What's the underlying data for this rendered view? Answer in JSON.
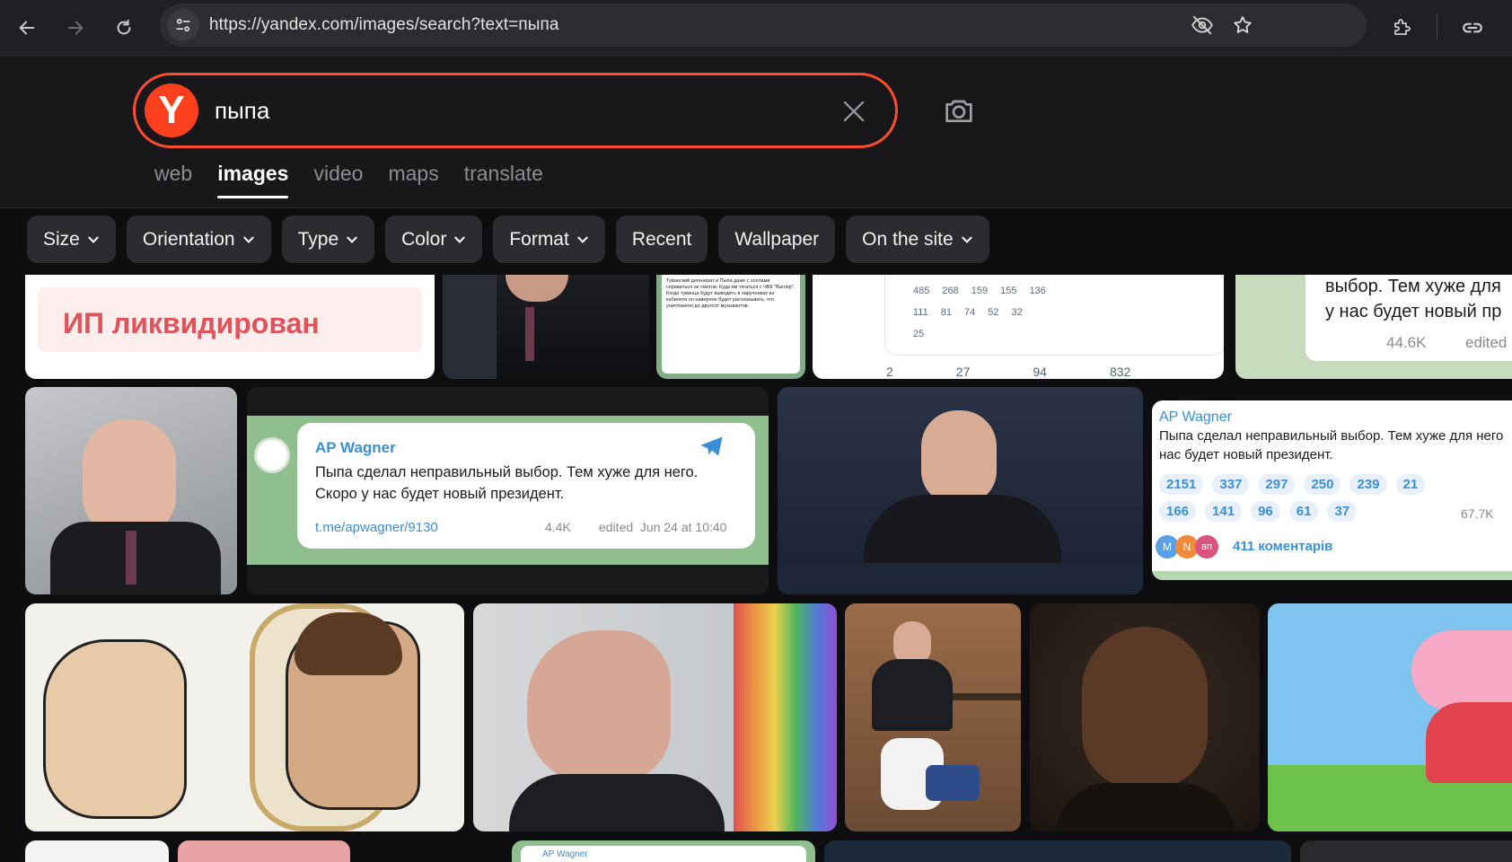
{
  "browser": {
    "url": "https://yandex.com/images/search?text=пыпа"
  },
  "search": {
    "query": "пыпа",
    "logo_letter": "Y"
  },
  "tabs": [
    {
      "label": "web",
      "active": false
    },
    {
      "label": "images",
      "active": true
    },
    {
      "label": "video",
      "active": false
    },
    {
      "label": "maps",
      "active": false
    },
    {
      "label": "translate",
      "active": false
    }
  ],
  "filters": [
    {
      "label": "Size",
      "dropdown": true
    },
    {
      "label": "Orientation",
      "dropdown": true
    },
    {
      "label": "Type",
      "dropdown": true
    },
    {
      "label": "Color",
      "dropdown": true
    },
    {
      "label": "Format",
      "dropdown": true
    },
    {
      "label": "Recent",
      "dropdown": false
    },
    {
      "label": "Wallpaper",
      "dropdown": false
    },
    {
      "label": "On the site",
      "dropdown": true
    }
  ],
  "results": {
    "row1": {
      "ip_text": "ИП ликвидирован",
      "reactions_small": [
        "485",
        "268",
        "159",
        "155",
        "136",
        "111",
        "81",
        "74",
        "52",
        "32",
        "25"
      ],
      "stats": [
        "2",
        "27",
        "94",
        "832"
      ],
      "partial_text_1": "выбор. Тем хуже для",
      "partial_text_2": "у нас будет новый пр",
      "partial_views": "44.6K",
      "partial_edited": "edited",
      "tg_text_small": "Тувинский дегенерат и Пыпа даже с хохлами справиться не смогли. Куда им тягаться с ЧВК \"Вагнер\". Когда тувинца будут выводить в наручниках из кабинета он наверное будет рассказывать, что уничтожено до двухсот музыкантов."
    },
    "row2": {
      "channel": "AP Wagner",
      "message_1": "Пыпа сделал неправильный выбор. Тем хуже для него.",
      "message_2": "Скоро у нас будет новый президент.",
      "link": "t.me/apwagner/9130",
      "views": "4.4K",
      "edited": "edited  Jun 24 at 10:40",
      "card2_channel": "AP Wagner",
      "card2_msg_1": "Пыпа сделал неправильный выбор. Тем хуже для него",
      "card2_msg_2": "нас будет новый президент.",
      "reactions": [
        "2151",
        "337",
        "297",
        "250",
        "239",
        "21",
        "166",
        "141",
        "96",
        "61",
        "37"
      ],
      "card2_views": "67.7K",
      "comments": "411 коментарів",
      "avatar_letters": [
        "M",
        "N",
        "вп"
      ]
    },
    "row4": {
      "channel": "AP Wagner"
    }
  },
  "colors": {
    "accent": "#fc3f1d",
    "telegram_blue": "#3a8fd6",
    "chip_bg": "#2c2c30"
  }
}
